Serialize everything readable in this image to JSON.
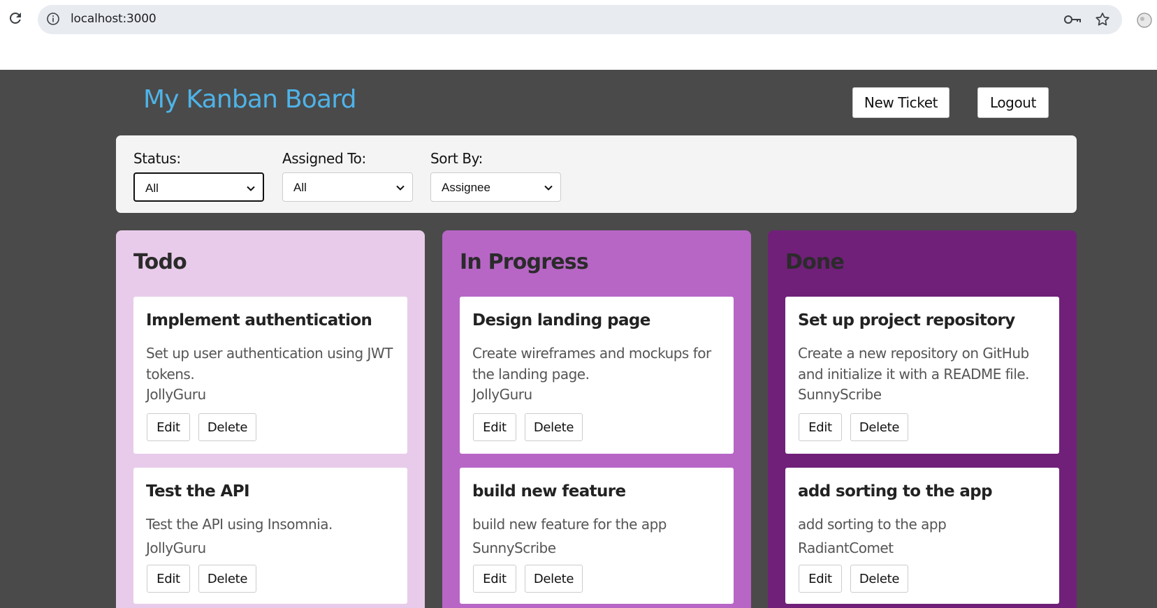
{
  "browser": {
    "url": "localhost:3000"
  },
  "header": {
    "title": "My Kanban Board",
    "new_ticket_label": "New Ticket",
    "logout_label": "Logout"
  },
  "filters": {
    "status": {
      "label": "Status:",
      "value": "All"
    },
    "assigned_to": {
      "label": "Assigned To:",
      "value": "All"
    },
    "sort_by": {
      "label": "Sort By:",
      "value": "Assignee"
    }
  },
  "columns": [
    {
      "title": "Todo",
      "color": "#e8cbea",
      "cards": [
        {
          "title": "Implement authentication",
          "description": "Set up user authentication using JWT tokens.",
          "assignee": "JollyGuru",
          "edit_label": "Edit",
          "delete_label": "Delete"
        },
        {
          "title": "Test the API",
          "description": "Test the API using Insomnia.",
          "assignee": "JollyGuru",
          "edit_label": "Edit",
          "delete_label": "Delete"
        }
      ]
    },
    {
      "title": "In Progress",
      "color": "#b766c6",
      "cards": [
        {
          "title": "Design landing page",
          "description": "Create wireframes and mockups for the landing page.",
          "assignee": "JollyGuru",
          "edit_label": "Edit",
          "delete_label": "Delete"
        },
        {
          "title": "build new feature",
          "description": "build new feature for the app",
          "assignee": "SunnyScribe",
          "edit_label": "Edit",
          "delete_label": "Delete"
        }
      ]
    },
    {
      "title": "Done",
      "color": "#702079",
      "cards": [
        {
          "title": "Set up project repository",
          "description": "Create a new repository on GitHub and initialize it with a README file.",
          "assignee": "SunnyScribe",
          "edit_label": "Edit",
          "delete_label": "Delete"
        },
        {
          "title": "add sorting to the app",
          "description": "add sorting to the app",
          "assignee": "RadiantComet",
          "edit_label": "Edit",
          "delete_label": "Delete"
        }
      ]
    }
  ],
  "colors": {
    "app_background": "#4a4a4a",
    "title_accent": "#4fb3e8"
  }
}
